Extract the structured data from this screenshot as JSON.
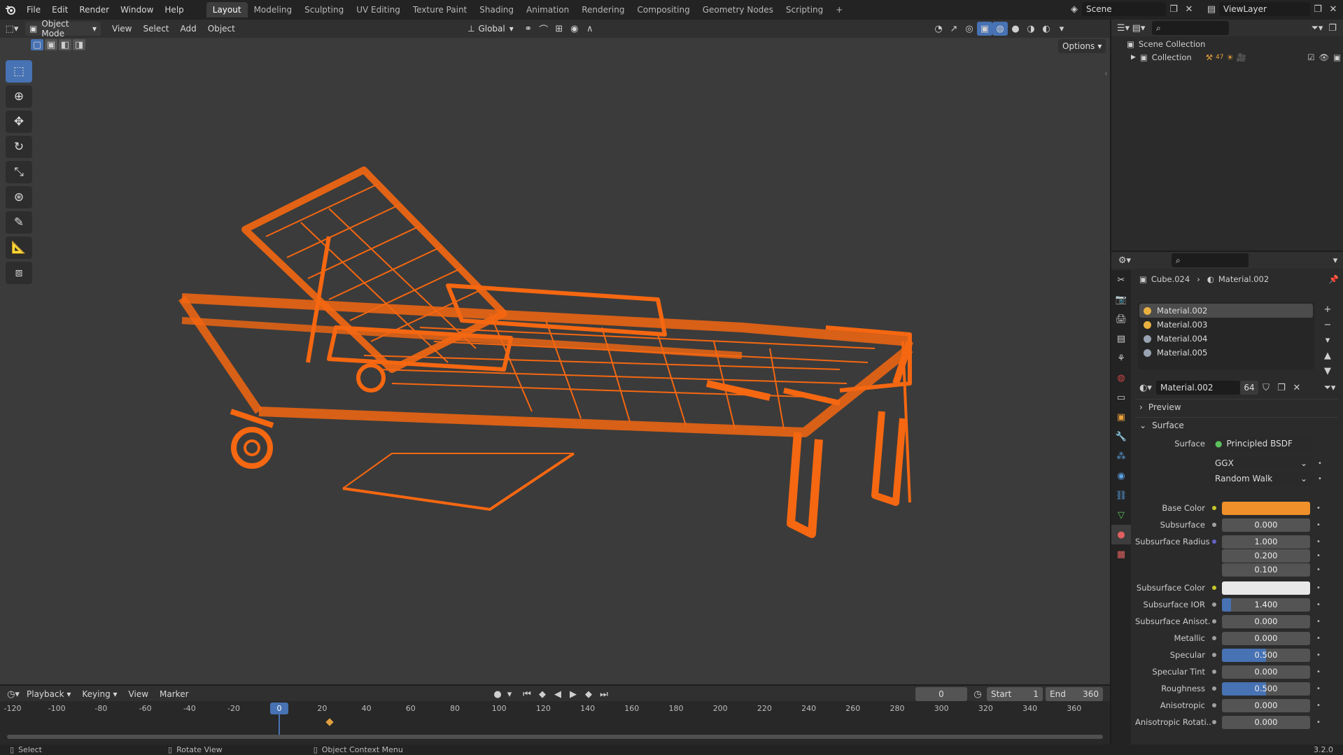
{
  "topbar": {
    "menus": [
      "File",
      "Edit",
      "Render",
      "Window",
      "Help"
    ],
    "workspaces": [
      "Layout",
      "Modeling",
      "Sculpting",
      "UV Editing",
      "Texture Paint",
      "Shading",
      "Animation",
      "Rendering",
      "Compositing",
      "Geometry Nodes",
      "Scripting"
    ],
    "active_workspace": "Layout",
    "add_tab": "+",
    "scene_name": "Scene",
    "view_layer": "ViewLayer"
  },
  "viewport_header": {
    "mode": "Object Mode",
    "menus": [
      "View",
      "Select",
      "Add",
      "Object"
    ],
    "orientation": "Global",
    "options": "Options"
  },
  "toolbar": [
    "select-box",
    "cursor",
    "move",
    "rotate",
    "scale",
    "transform",
    "annotate",
    "measure",
    "add-cube"
  ],
  "viewport": {
    "wire_color": "#ff6a0f",
    "background": "#3b3b3b"
  },
  "timeline": {
    "menus": [
      "Playback",
      "Keying",
      "View",
      "Marker"
    ],
    "current_frame": "0",
    "start_label": "Start",
    "start_value": "1",
    "end_label": "End",
    "end_value": "360",
    "ticks": [
      "-120",
      "-100",
      "-80",
      "-60",
      "-40",
      "-20",
      "0",
      "20",
      "40",
      "60",
      "80",
      "100",
      "120",
      "140",
      "160",
      "180",
      "200",
      "220",
      "240",
      "260",
      "280",
      "300",
      "320",
      "340",
      "360"
    ]
  },
  "statusbar": {
    "select": "Select",
    "rotate": "Rotate View",
    "context": "Object Context Menu",
    "version": "3.2.0"
  },
  "outliner": {
    "scene_collection": "Scene Collection",
    "collection": "Collection",
    "badge": "47"
  },
  "properties": {
    "breadcrumb_object": "Cube.024",
    "breadcrumb_material": "Material.002",
    "slots": [
      "Material.002",
      "Material.003",
      "Material.004",
      "Material.005"
    ],
    "material_name": "Material.002",
    "user_count": "64",
    "preview_label": "Preview",
    "surface_panel": "Surface",
    "surface_label": "Surface",
    "surface_value": "Principled BSDF",
    "distribution": "GGX",
    "subsurface_method": "Random Walk",
    "base_color_hex": "#f0902a",
    "subsurface_color_hex": "#e8e8e8",
    "rows": [
      {
        "label": "Base Color",
        "kind": "color"
      },
      {
        "label": "Subsurface",
        "value": "0.000",
        "fraction": 0
      },
      {
        "label": "Subsurface Radius",
        "value": "1.000",
        "fraction": 0
      },
      {
        "label": "",
        "value": "0.200",
        "fraction": 0
      },
      {
        "label": "",
        "value": "0.100",
        "fraction": 0
      },
      {
        "label": "Subsurface Color",
        "kind": "color"
      },
      {
        "label": "Subsurface IOR",
        "value": "1.400",
        "fraction": 0.1
      },
      {
        "label": "Subsurface Anisot...",
        "value": "0.000",
        "fraction": 0
      },
      {
        "label": "Metallic",
        "value": "0.000",
        "fraction": 0
      },
      {
        "label": "Specular",
        "value": "0.500",
        "fraction": 0.5
      },
      {
        "label": "Specular Tint",
        "value": "0.000",
        "fraction": 0
      },
      {
        "label": "Roughness",
        "value": "0.500",
        "fraction": 0.5
      },
      {
        "label": "Anisotropic",
        "value": "0.000",
        "fraction": 0
      },
      {
        "label": "Anisotropic Rotati...",
        "value": "0.000",
        "fraction": 0
      }
    ]
  }
}
